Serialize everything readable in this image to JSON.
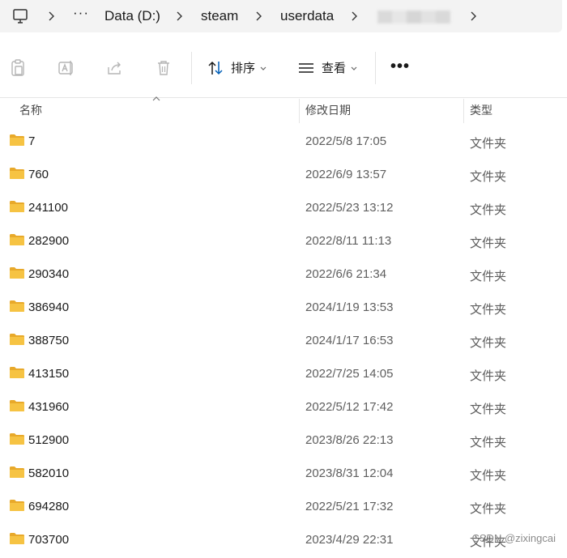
{
  "address": {
    "overflow_label": "···",
    "crumbs": [
      "Data (D:)",
      "steam",
      "userdata"
    ]
  },
  "toolbar": {
    "sort_label": "排序",
    "view_label": "查看",
    "more_label": "•••"
  },
  "columns": {
    "name": "名称",
    "modified": "修改日期",
    "type": "类型"
  },
  "rows": [
    {
      "name": "7",
      "date": "2022/5/8 17:05",
      "type": "文件夹"
    },
    {
      "name": "760",
      "date": "2022/6/9 13:57",
      "type": "文件夹"
    },
    {
      "name": "241100",
      "date": "2022/5/23 13:12",
      "type": "文件夹"
    },
    {
      "name": "282900",
      "date": "2022/8/11 11:13",
      "type": "文件夹"
    },
    {
      "name": "290340",
      "date": "2022/6/6 21:34",
      "type": "文件夹"
    },
    {
      "name": "386940",
      "date": "2024/1/19 13:53",
      "type": "文件夹"
    },
    {
      "name": "388750",
      "date": "2024/1/17 16:53",
      "type": "文件夹"
    },
    {
      "name": "413150",
      "date": "2022/7/25 14:05",
      "type": "文件夹"
    },
    {
      "name": "431960",
      "date": "2022/5/12 17:42",
      "type": "文件夹"
    },
    {
      "name": "512900",
      "date": "2023/8/26 22:13",
      "type": "文件夹"
    },
    {
      "name": "582010",
      "date": "2023/8/31 12:04",
      "type": "文件夹"
    },
    {
      "name": "694280",
      "date": "2022/5/21 17:32",
      "type": "文件夹"
    },
    {
      "name": "703700",
      "date": "2023/4/29 22:31",
      "type": "文件夹"
    }
  ],
  "watermark": "CSDN @zixingcai",
  "colors": {
    "folder": "#f6c343",
    "folder_dark": "#e8a92a",
    "accent": "#005fb8"
  }
}
